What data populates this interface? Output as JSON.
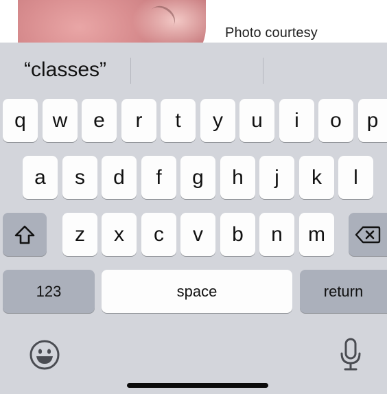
{
  "background": {
    "caption": "Photo courtesy"
  },
  "keyboard": {
    "suggestions": [
      "“classes”",
      "",
      ""
    ],
    "rows": [
      [
        "q",
        "w",
        "e",
        "r",
        "t",
        "y",
        "u",
        "i",
        "o",
        "p"
      ],
      [
        "a",
        "s",
        "d",
        "f",
        "g",
        "h",
        "j",
        "k",
        "l"
      ],
      [
        "z",
        "x",
        "c",
        "v",
        "b",
        "n",
        "m"
      ]
    ],
    "numbers_label": "123",
    "space_label": "space",
    "return_label": "return",
    "shift_icon": "shift-icon",
    "delete_icon": "delete-icon",
    "emoji_icon": "emoji-icon",
    "dictation_icon": "microphone-icon"
  },
  "colors": {
    "keyboard_bg": "#d3d5db",
    "key_bg": "#fdfdfd",
    "special_key_bg": "#abb0bb"
  }
}
